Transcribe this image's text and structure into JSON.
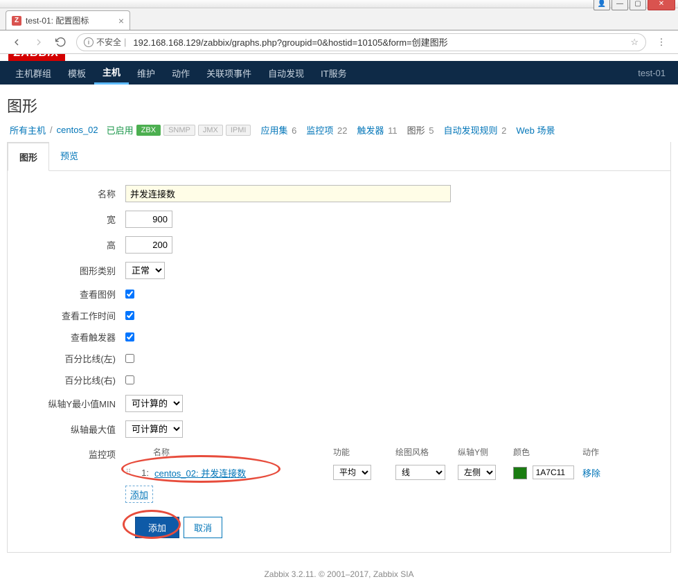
{
  "browser": {
    "tab_title": "test-01: 配置图标",
    "favicon_letter": "Z",
    "insecure_label": "不安全",
    "url": "192.168.168.129/zabbix/graphs.php?groupid=0&hostid=10105&form=创建图形"
  },
  "logo": "ZABBIX",
  "nav": {
    "items": [
      "主机群组",
      "模板",
      "主机",
      "维护",
      "动作",
      "关联项事件",
      "自动发现",
      "IT服务"
    ],
    "active_index": 2,
    "right": "test-01"
  },
  "page": {
    "title": "图形",
    "breadcrumb": {
      "all_hosts": "所有主机",
      "host": "centos_02",
      "enabled": "已启用",
      "badges": [
        "ZBX",
        "SNMP",
        "JMX",
        "IPMI"
      ]
    },
    "stats": [
      {
        "label": "应用集",
        "count": "6"
      },
      {
        "label": "监控项",
        "count": "22"
      },
      {
        "label": "触发器",
        "count": "11"
      },
      {
        "label": "图形",
        "count": "5",
        "current": true
      },
      {
        "label": "自动发现规则",
        "count": "2"
      },
      {
        "label": "Web 场景",
        "count": ""
      }
    ],
    "tabs": {
      "graph": "图形",
      "preview": "预览"
    }
  },
  "form": {
    "name_label": "名称",
    "name_value": "并发连接数",
    "width_label": "宽",
    "width_value": "900",
    "height_label": "高",
    "height_value": "200",
    "type_label": "图形类别",
    "type_value": "正常",
    "show_legend_label": "查看图例",
    "show_work_label": "查看工作时间",
    "show_trig_label": "查看触发器",
    "pct_left_label": "百分比线(左)",
    "pct_right_label": "百分比线(右)",
    "ymin_label": "纵轴Y最小值MIN",
    "ymin_value": "可计算的",
    "ymax_label": "纵轴最大值",
    "ymax_value": "可计算的",
    "items_label": "监控项",
    "headers": {
      "name": "名称",
      "func": "功能",
      "style": "绘图风格",
      "side": "纵轴Y侧",
      "color": "颜色",
      "action": "动作"
    },
    "item_row": {
      "idx": "1:",
      "name": "centos_02: 并发连接数",
      "func": "平均",
      "style": "线",
      "side": "左侧",
      "color": "1A7C11",
      "action": "移除"
    },
    "add_item": "添加",
    "submit": "添加",
    "cancel": "取消"
  },
  "footer": "Zabbix 3.2.11. © 2001–2017, Zabbix SIA"
}
